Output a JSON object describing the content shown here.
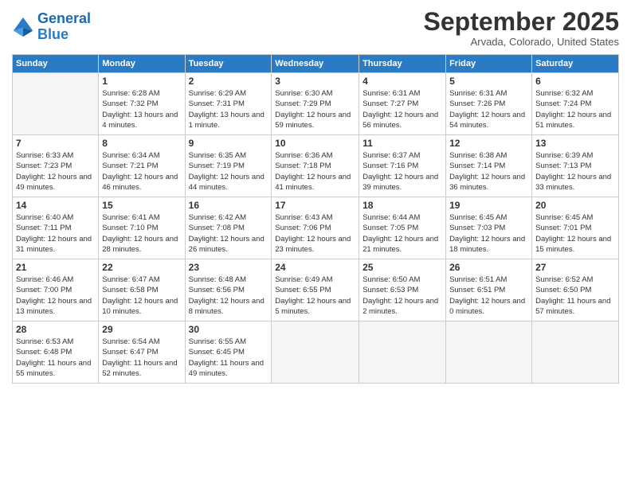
{
  "header": {
    "logo_line1": "General",
    "logo_line2": "Blue",
    "month": "September 2025",
    "location": "Arvada, Colorado, United States"
  },
  "days_of_week": [
    "Sunday",
    "Monday",
    "Tuesday",
    "Wednesday",
    "Thursday",
    "Friday",
    "Saturday"
  ],
  "weeks": [
    [
      {
        "day": "",
        "empty": true
      },
      {
        "day": "1",
        "sunrise": "6:28 AM",
        "sunset": "7:32 PM",
        "daylight": "13 hours and 4 minutes."
      },
      {
        "day": "2",
        "sunrise": "6:29 AM",
        "sunset": "7:31 PM",
        "daylight": "13 hours and 1 minute."
      },
      {
        "day": "3",
        "sunrise": "6:30 AM",
        "sunset": "7:29 PM",
        "daylight": "12 hours and 59 minutes."
      },
      {
        "day": "4",
        "sunrise": "6:31 AM",
        "sunset": "7:27 PM",
        "daylight": "12 hours and 56 minutes."
      },
      {
        "day": "5",
        "sunrise": "6:31 AM",
        "sunset": "7:26 PM",
        "daylight": "12 hours and 54 minutes."
      },
      {
        "day": "6",
        "sunrise": "6:32 AM",
        "sunset": "7:24 PM",
        "daylight": "12 hours and 51 minutes."
      }
    ],
    [
      {
        "day": "7",
        "sunrise": "6:33 AM",
        "sunset": "7:23 PM",
        "daylight": "12 hours and 49 minutes."
      },
      {
        "day": "8",
        "sunrise": "6:34 AM",
        "sunset": "7:21 PM",
        "daylight": "12 hours and 46 minutes."
      },
      {
        "day": "9",
        "sunrise": "6:35 AM",
        "sunset": "7:19 PM",
        "daylight": "12 hours and 44 minutes."
      },
      {
        "day": "10",
        "sunrise": "6:36 AM",
        "sunset": "7:18 PM",
        "daylight": "12 hours and 41 minutes."
      },
      {
        "day": "11",
        "sunrise": "6:37 AM",
        "sunset": "7:16 PM",
        "daylight": "12 hours and 39 minutes."
      },
      {
        "day": "12",
        "sunrise": "6:38 AM",
        "sunset": "7:14 PM",
        "daylight": "12 hours and 36 minutes."
      },
      {
        "day": "13",
        "sunrise": "6:39 AM",
        "sunset": "7:13 PM",
        "daylight": "12 hours and 33 minutes."
      }
    ],
    [
      {
        "day": "14",
        "sunrise": "6:40 AM",
        "sunset": "7:11 PM",
        "daylight": "12 hours and 31 minutes."
      },
      {
        "day": "15",
        "sunrise": "6:41 AM",
        "sunset": "7:10 PM",
        "daylight": "12 hours and 28 minutes."
      },
      {
        "day": "16",
        "sunrise": "6:42 AM",
        "sunset": "7:08 PM",
        "daylight": "12 hours and 26 minutes."
      },
      {
        "day": "17",
        "sunrise": "6:43 AM",
        "sunset": "7:06 PM",
        "daylight": "12 hours and 23 minutes."
      },
      {
        "day": "18",
        "sunrise": "6:44 AM",
        "sunset": "7:05 PM",
        "daylight": "12 hours and 21 minutes."
      },
      {
        "day": "19",
        "sunrise": "6:45 AM",
        "sunset": "7:03 PM",
        "daylight": "12 hours and 18 minutes."
      },
      {
        "day": "20",
        "sunrise": "6:45 AM",
        "sunset": "7:01 PM",
        "daylight": "12 hours and 15 minutes."
      }
    ],
    [
      {
        "day": "21",
        "sunrise": "6:46 AM",
        "sunset": "7:00 PM",
        "daylight": "12 hours and 13 minutes."
      },
      {
        "day": "22",
        "sunrise": "6:47 AM",
        "sunset": "6:58 PM",
        "daylight": "12 hours and 10 minutes."
      },
      {
        "day": "23",
        "sunrise": "6:48 AM",
        "sunset": "6:56 PM",
        "daylight": "12 hours and 8 minutes."
      },
      {
        "day": "24",
        "sunrise": "6:49 AM",
        "sunset": "6:55 PM",
        "daylight": "12 hours and 5 minutes."
      },
      {
        "day": "25",
        "sunrise": "6:50 AM",
        "sunset": "6:53 PM",
        "daylight": "12 hours and 2 minutes."
      },
      {
        "day": "26",
        "sunrise": "6:51 AM",
        "sunset": "6:51 PM",
        "daylight": "12 hours and 0 minutes."
      },
      {
        "day": "27",
        "sunrise": "6:52 AM",
        "sunset": "6:50 PM",
        "daylight": "11 hours and 57 minutes."
      }
    ],
    [
      {
        "day": "28",
        "sunrise": "6:53 AM",
        "sunset": "6:48 PM",
        "daylight": "11 hours and 55 minutes."
      },
      {
        "day": "29",
        "sunrise": "6:54 AM",
        "sunset": "6:47 PM",
        "daylight": "11 hours and 52 minutes."
      },
      {
        "day": "30",
        "sunrise": "6:55 AM",
        "sunset": "6:45 PM",
        "daylight": "11 hours and 49 minutes."
      },
      {
        "day": "",
        "empty": true
      },
      {
        "day": "",
        "empty": true
      },
      {
        "day": "",
        "empty": true
      },
      {
        "day": "",
        "empty": true
      }
    ]
  ]
}
